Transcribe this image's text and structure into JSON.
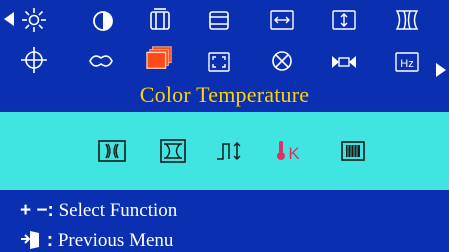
{
  "menu": {
    "title": "Color Temperature",
    "selected_icon": "color-temperature-icon",
    "top_row_icons": [
      "brightness-icon",
      "contrast-icon",
      "h-size-icon",
      "v-size-icon",
      "h-position-icon",
      "v-position-icon",
      "pincushion-icon"
    ],
    "bottom_row_icons": [
      "geometry-icon",
      "recall-icon",
      "color-temperature-icon",
      "zoom-icon",
      "degauss-icon",
      "input-select-icon",
      "hz-icon"
    ],
    "hz_label": "Hz",
    "k_label": "K"
  },
  "submenu": {
    "icons": [
      "pincushion-adjust-icon",
      "trapezoid-adjust-icon",
      "moire-adjust-icon",
      "color-kelvin-icon",
      "color-select-icon"
    ]
  },
  "help": {
    "line1_symbol": "+ −:",
    "line1_text": "Select Function",
    "line2_symbol": ":",
    "line2_text": "Previous Menu"
  },
  "colors": {
    "background": "#0a2fb0",
    "panel": "#40e4e0",
    "title": "#ffd400",
    "selected": "#ff4a1a",
    "kelvin": "#e03060"
  }
}
